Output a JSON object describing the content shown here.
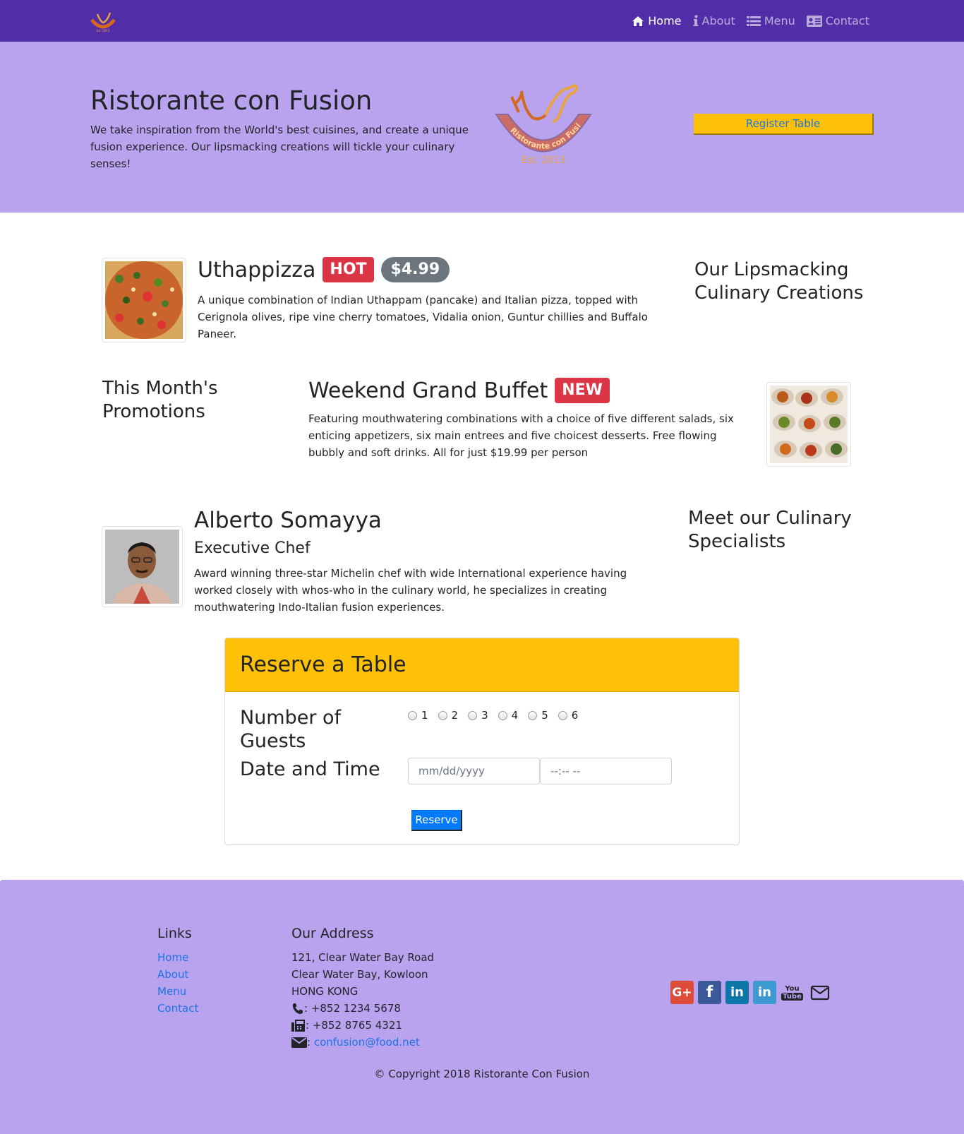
{
  "colors": {
    "primary": "#512DA8",
    "jumbotron": "#B9A3EE",
    "warning": "#FFC107",
    "danger": "#dc3545",
    "link": "#1a73e8",
    "button_primary": "#007bff"
  },
  "nav": {
    "logo_icon": "restaurant-logo",
    "items": [
      {
        "label": "Home",
        "icon": "home-icon",
        "active": true
      },
      {
        "label": "About",
        "icon": "info-icon",
        "active": false
      },
      {
        "label": "Menu",
        "icon": "list-icon",
        "active": false
      },
      {
        "label": "Contact",
        "icon": "address-card-icon",
        "active": false
      }
    ]
  },
  "jumbotron": {
    "title": "Ristorante con Fusion",
    "description": "We take inspiration from the World's best cuisines, and create a unique fusion experience. Our lipsmacking creations will tickle your culinary senses!",
    "logo_arc_text": "Ristorante con Fusion",
    "logo_est": "Est. 2013",
    "register_button": "Register Table"
  },
  "dish": {
    "name": "Uthappizza",
    "badge": "HOT",
    "price": "$4.99",
    "description": "A unique combination of Indian Uthappam (pancake) and Italian pizza, topped with Cerignola olives, ripe vine cherry tomatoes, Vidalia onion, Guntur chillies and Buffalo Paneer.",
    "side_heading": "Our Lipsmacking Culinary Creations"
  },
  "promotion": {
    "side_heading": "This Month's Promotions",
    "name": "Weekend Grand Buffet",
    "badge": "NEW",
    "description": "Featuring mouthwatering combinations with a choice of five different salads, six enticing appetizers, six main entrees and five choicest desserts. Free flowing bubbly and soft drinks. All for just $19.99 per person"
  },
  "leader": {
    "name": "Alberto Somayya",
    "designation": "Executive Chef",
    "description": "Award winning three-star Michelin chef with wide International experience having worked closely with whos-who in the culinary world, he specializes in creating mouthwatering Indo-Italian fusion experiences.",
    "side_heading": "Meet our Culinary Specialists"
  },
  "reserve": {
    "title": "Reserve a Table",
    "guests_label": "Number of Guests",
    "guest_options": [
      "1",
      "2",
      "3",
      "4",
      "5",
      "6"
    ],
    "datetime_label": "Date and Time",
    "date_placeholder": "mm/dd/yyyy",
    "time_placeholder": "--:-- --",
    "button": "Reserve"
  },
  "footer": {
    "links_heading": "Links",
    "links": [
      "Home",
      "About",
      "Menu",
      "Contact"
    ],
    "address_heading": "Our Address",
    "address_lines": [
      "121, Clear Water Bay Road",
      "Clear Water Bay, Kowloon",
      "HONG KONG"
    ],
    "phone": ": +852 1234 5678",
    "fax": ": +852 8765 4321",
    "email_prefix": ": ",
    "email": "confusion@food.net",
    "social_icons": [
      "google-plus-icon",
      "facebook-icon",
      "linkedin-icon",
      "linkedin-icon",
      "youtube-icon",
      "envelope-icon"
    ],
    "copyright": "© Copyright 2018 Ristorante Con Fusion"
  }
}
